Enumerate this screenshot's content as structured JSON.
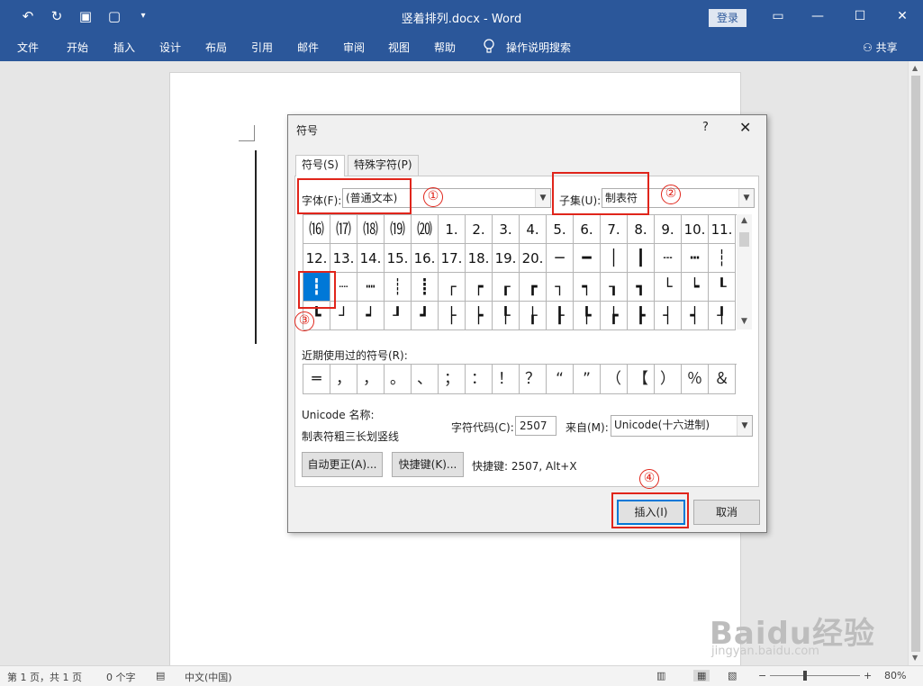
{
  "window": {
    "title": "竖着排列.docx  -  Word",
    "login": "登录",
    "qat_icons": [
      "undo-icon",
      "redo-icon",
      "save-icon",
      "new-doc-icon",
      "customize-icon"
    ],
    "controls": [
      "ribbon-display-icon",
      "minimize-icon",
      "maximize-icon",
      "close-icon"
    ]
  },
  "ribbon": {
    "tabs": [
      "文件",
      "开始",
      "插入",
      "设计",
      "布局",
      "引用",
      "邮件",
      "审阅",
      "视图",
      "帮助"
    ],
    "tell_me": "操作说明搜索",
    "share": "共享"
  },
  "dialog": {
    "title": "符号",
    "help": "?",
    "close": "✕",
    "tabs": [
      "符号(S)",
      "特殊字符(P)"
    ],
    "font_label": "字体(F):",
    "font_value": "(普通文本)",
    "subset_label": "子集(U):",
    "subset_value": "制表符",
    "grid": [
      [
        "⒃",
        "⒄",
        "⒅",
        "⒆",
        "⒇",
        "1.",
        "2.",
        "3.",
        "4.",
        "5.",
        "6.",
        "7.",
        "8.",
        "9.",
        "10.",
        "11."
      ],
      [
        "12.",
        "13.",
        "14.",
        "15.",
        "16.",
        "17.",
        "18.",
        "19.",
        "20.",
        "─",
        "━",
        "│",
        "┃",
        "┄",
        "┅",
        "┆"
      ],
      [
        "┇",
        "┈",
        "┉",
        "┊",
        "┋",
        "┌",
        "┍",
        "┎",
        "┏",
        "┐",
        "┑",
        "┒",
        "┓",
        "└",
        "┕",
        "┖"
      ],
      [
        "┗",
        "┘",
        "┙",
        "┚",
        "┛",
        "├",
        "┝",
        "┞",
        "┟",
        "┠",
        "┡",
        "┢",
        "┣",
        "┤",
        "┥",
        "┦"
      ]
    ],
    "selected_cell": "┇",
    "recent_label": "近期使用过的符号(R):",
    "recent": [
      "═",
      "，",
      "，",
      "。",
      "、",
      "；",
      "：",
      "！",
      "？",
      "“",
      "”",
      "（",
      "【",
      "）",
      "％",
      "＆"
    ],
    "unicode_name_label": "Unicode 名称:",
    "unicode_name": "制表符粗三长划竖线",
    "char_code_label": "字符代码(C):",
    "char_code": "2507",
    "from_label": "来自(M):",
    "from_value": "Unicode(十六进制)",
    "autocorrect_btn": "自动更正(A)...",
    "shortcut_btn": "快捷键(K)...",
    "shortcut_text": "快捷键: 2507, Alt+X",
    "insert_btn": "插入(I)",
    "cancel_btn": "取消"
  },
  "annotations": [
    "①",
    "②",
    "③",
    "④"
  ],
  "status": {
    "page": "第 1 页，共 1 页",
    "words": "0 个字",
    "language": "中文(中国)",
    "zoom": "80%"
  },
  "watermark": {
    "logo": "Baidu经验",
    "url": "jingyan.baidu.com"
  },
  "colors": {
    "word_blue": "#2b579a",
    "selection": "#0078d7",
    "annotation_red": "#e0251b"
  }
}
